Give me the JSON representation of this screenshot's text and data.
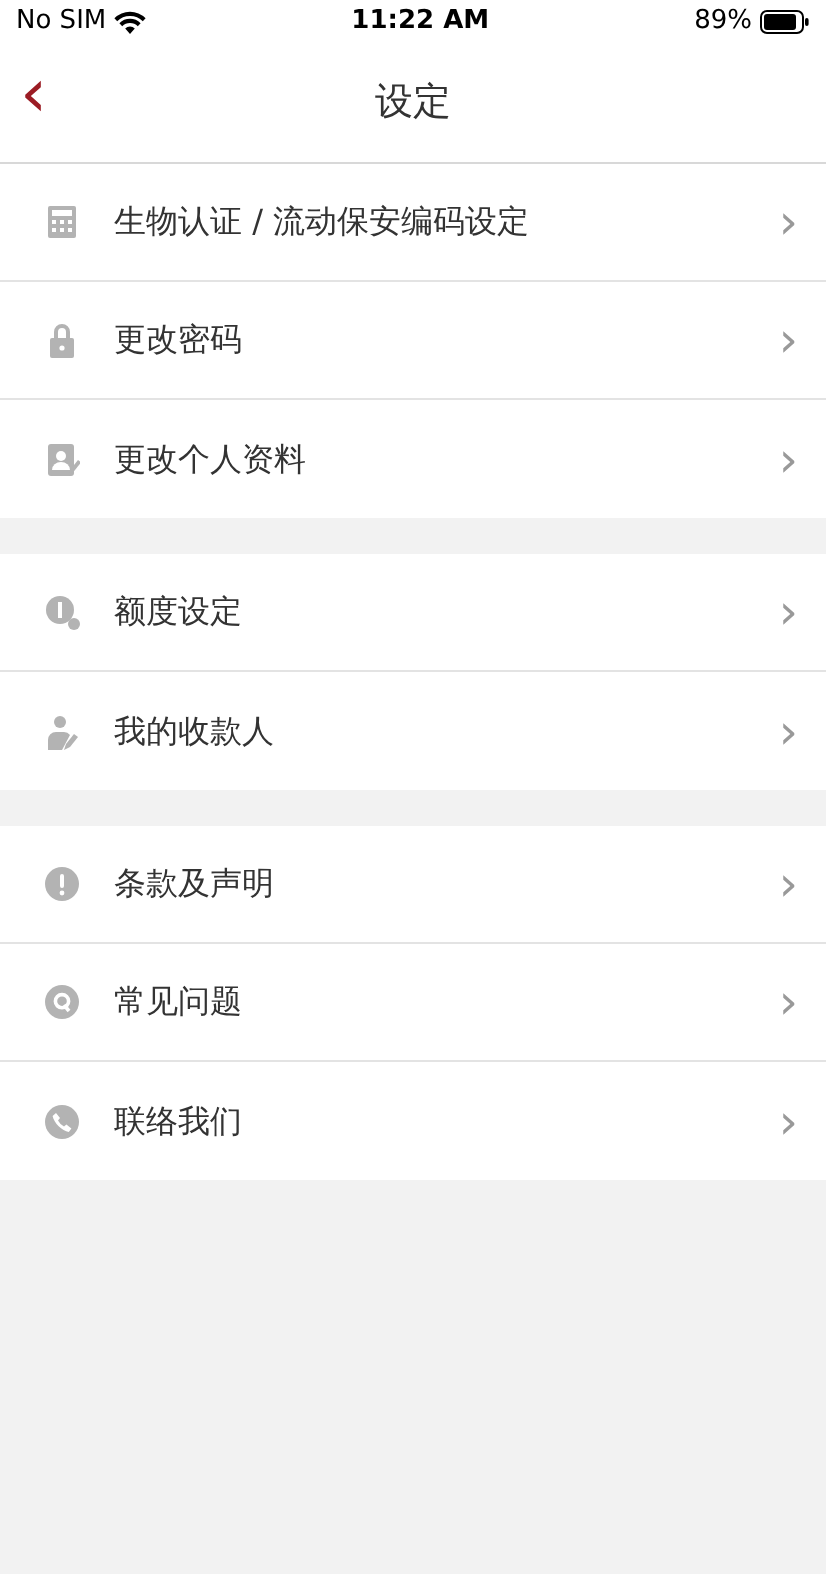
{
  "status_bar": {
    "carrier": "No SIM",
    "time": "11:22 AM",
    "battery": "89%"
  },
  "nav": {
    "back": "‹",
    "title": "设定"
  },
  "groups": [
    {
      "items": [
        {
          "label": "生物认证 / 流动保安编码设定",
          "chevron": "›"
        },
        {
          "label": "更改密码",
          "chevron": "›"
        },
        {
          "label": "更改个人资料",
          "chevron": "›"
        }
      ]
    },
    {
      "items": [
        {
          "label": "额度设定",
          "chevron": "›"
        },
        {
          "label": "我的收款人",
          "chevron": "›"
        }
      ]
    },
    {
      "items": [
        {
          "label": "条款及声明",
          "chevron": "›"
        },
        {
          "label": "常见问题",
          "chevron": "›"
        },
        {
          "label": "联络我们",
          "chevron": "›"
        }
      ]
    }
  ]
}
